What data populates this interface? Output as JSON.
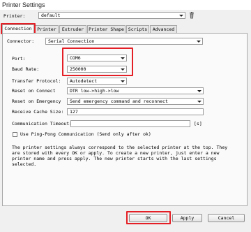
{
  "window": {
    "title": "Printer Settings"
  },
  "printer": {
    "label": "Printer:",
    "value": "default"
  },
  "tabs": [
    {
      "label": "Connection"
    },
    {
      "label": "Printer"
    },
    {
      "label": "Extruder"
    },
    {
      "label": "Printer Shape"
    },
    {
      "label": "Scripts"
    },
    {
      "label": "Advanced"
    }
  ],
  "connection": {
    "connector_label": "Connector:",
    "connector_value": "Serial Connection",
    "port_label": "Port:",
    "port_value": "COM6",
    "baud_label": "Baud Rate:",
    "baud_value": "250000",
    "transfer_label": "Transfer Protocol:",
    "transfer_value": "Autodetect",
    "reset_connect_label": "Reset on Connect",
    "reset_connect_value": "DTR low->high->low",
    "reset_emergency_label": "Reset on Emergency",
    "reset_emergency_value": "Send emergency command and reconnect",
    "cache_label": "Receive Cache Size:",
    "cache_value": "127",
    "timeout_label": "Communication Timeout:",
    "timeout_value": "",
    "timeout_unit": "[s]",
    "pingpong_label": "Use Ping-Pong Communication (Send only after ok)",
    "description": "The printer settings always correspond to the selected printer at the top. They\nare stored with every OK or apply. To create a new printer, just enter a new\nprinter name and press apply. The new printer starts with the last settings\nselected."
  },
  "buttons": {
    "ok": "OK",
    "apply": "Apply",
    "cancel": "Cancel"
  }
}
